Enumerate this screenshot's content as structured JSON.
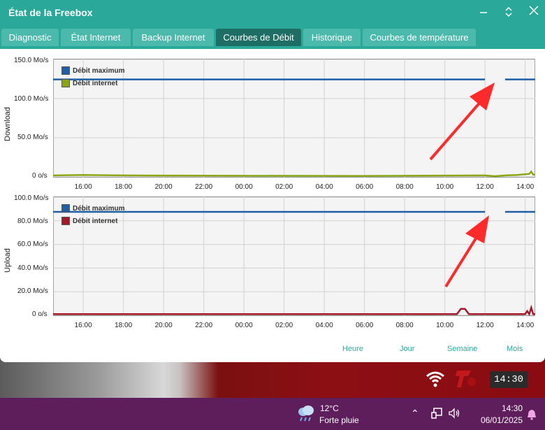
{
  "window": {
    "title": "État de la Freebox",
    "controls": {
      "minimize": "–",
      "restore": "⌃⌄",
      "close": "✕"
    }
  },
  "tabs": [
    {
      "label": "Diagnostic"
    },
    {
      "label": "État Internet"
    },
    {
      "label": "Backup Internet"
    },
    {
      "label": "Courbes de Débit",
      "active": true
    },
    {
      "label": "Historique"
    },
    {
      "label": "Courbes de température"
    }
  ],
  "range_links": [
    "Heure",
    "Jour",
    "Semaine",
    "Mois"
  ],
  "colors": {
    "accent": "#2aa89a",
    "max_line": "#1f5fa8",
    "download_line": "#8aa617",
    "upload_line": "#a3192a",
    "arrow": "#ff2a2a"
  },
  "chart_data": [
    {
      "type": "line",
      "name": "download",
      "ylabel": "Download",
      "yticks": [
        "150.0 Mo/s",
        "100.0 Mo/s",
        "50.0 Mo/s",
        "0 o/s"
      ],
      "xticks": [
        "16:00",
        "18:00",
        "20:00",
        "22:00",
        "00:00",
        "02:00",
        "04:00",
        "06:00",
        "08:00",
        "10:00",
        "12:00",
        "14:00"
      ],
      "ylim": [
        0,
        150
      ],
      "x_range_hours": [
        14.5,
        38.5
      ],
      "grid": true,
      "legend": "top-left",
      "series": [
        {
          "name": "Débit maximum",
          "points": [
            [
              14.5,
              125
            ],
            [
              36.0,
              125
            ],
            [
              37.0,
              125
            ],
            [
              38.5,
              125
            ]
          ],
          "gap": [
            36.0,
            37.0
          ]
        },
        {
          "name": "Débit internet",
          "points": [
            [
              14.5,
              1
            ],
            [
              16,
              1.5
            ],
            [
              18,
              1
            ],
            [
              20,
              0.8
            ],
            [
              24,
              0.5
            ],
            [
              30,
              0.4
            ],
            [
              34,
              0.8
            ],
            [
              36,
              1
            ],
            [
              36.5,
              0
            ],
            [
              37,
              1
            ],
            [
              37.6,
              1.5
            ],
            [
              38.2,
              3
            ],
            [
              38.3,
              6
            ],
            [
              38.4,
              2
            ],
            [
              38.5,
              2
            ]
          ]
        }
      ]
    },
    {
      "type": "line",
      "name": "upload",
      "ylabel": "Upload",
      "yticks": [
        "100.0 Mo/s",
        "80.0 Mo/s",
        "60.0 Mo/s",
        "40.0 Mo/s",
        "20.0 Mo/s",
        "0 o/s"
      ],
      "xticks": [
        "16:00",
        "18:00",
        "20:00",
        "22:00",
        "00:00",
        "02:00",
        "04:00",
        "06:00",
        "08:00",
        "10:00",
        "12:00",
        "14:00"
      ],
      "ylim": [
        0,
        100
      ],
      "x_range_hours": [
        14.5,
        38.5
      ],
      "grid": true,
      "legend": "top-left",
      "series": [
        {
          "name": "Débit maximum",
          "points": [
            [
              14.5,
              88
            ],
            [
              36.0,
              88
            ],
            [
              37.0,
              88
            ],
            [
              38.5,
              88
            ]
          ],
          "gap": [
            36.0,
            37.0
          ]
        },
        {
          "name": "Débit internet",
          "points": [
            [
              14.5,
              0.5
            ],
            [
              18,
              0.5
            ],
            [
              22,
              0.4
            ],
            [
              30,
              0.4
            ],
            [
              34.6,
              0.5
            ],
            [
              34.8,
              5
            ],
            [
              35.0,
              5
            ],
            [
              35.2,
              0.5
            ],
            [
              36,
              0.5
            ],
            [
              38.0,
              0.5
            ],
            [
              38.1,
              3
            ],
            [
              38.2,
              0.5
            ],
            [
              38.3,
              6
            ],
            [
              38.4,
              0.5
            ],
            [
              38.5,
              0.5
            ]
          ]
        }
      ]
    }
  ],
  "desktop": {
    "clock": "14:30"
  },
  "taskbar": {
    "weather_temp": "12°C",
    "weather_desc": "Forte pluie",
    "time": "14:30",
    "date": "06/01/2025"
  }
}
